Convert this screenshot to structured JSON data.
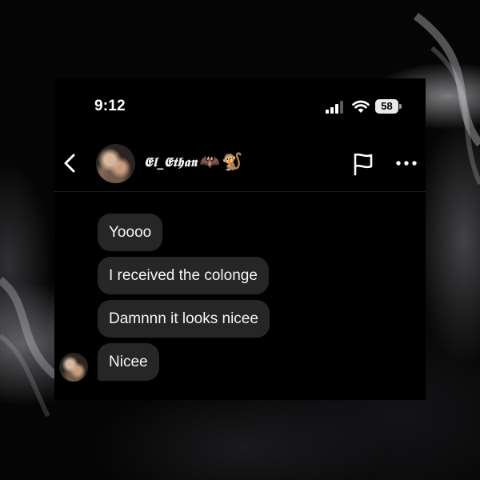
{
  "status_bar": {
    "time": "9:12",
    "battery_level": "58"
  },
  "chat": {
    "username": "𝕰𝖑_𝕰𝖙𝖍𝖆𝖓",
    "username_emojis": [
      "🦇",
      "🐒"
    ],
    "icons": {
      "back": "chevron-left-icon",
      "report": "flag-icon",
      "more": "ellipsis-icon"
    }
  },
  "messages": [
    {
      "text": "Yoooo"
    },
    {
      "text": "I received the colonge"
    },
    {
      "text": "Damnnn it looks nicee"
    },
    {
      "text": "Nicee"
    }
  ],
  "colors": {
    "background": "#000000",
    "bubble": "#262626",
    "text": "#ffffff"
  }
}
